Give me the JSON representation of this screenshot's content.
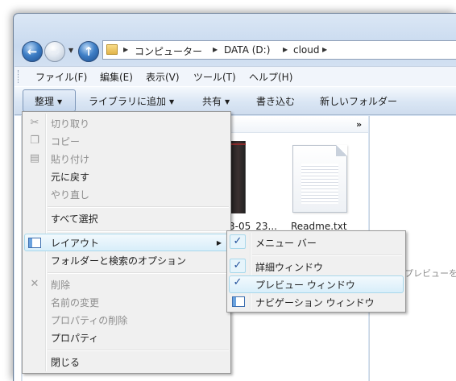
{
  "address": {
    "crumbs": [
      "コンピューター",
      "DATA (D:)",
      "cloud"
    ]
  },
  "menubar": {
    "items": [
      "ファイル(F)",
      "編集(E)",
      "表示(V)",
      "ツール(T)",
      "ヘルプ(H)"
    ]
  },
  "commandbar": {
    "organize": "整理",
    "add_to_library": "ライブラリに追加",
    "share": "共有",
    "burn": "書き込む",
    "new_folder": "新しいフォルダー"
  },
  "files": {
    "item1_label": "3-05_23...",
    "item2_label": "Readme.txt"
  },
  "preview": {
    "text": "プレビューを"
  },
  "organize_menu": {
    "cut": "切り取り",
    "copy": "コピー",
    "paste": "貼り付け",
    "undo": "元に戻す",
    "redo": "やり直し",
    "select_all": "すべて選択",
    "layout": "レイアウト",
    "folder_options": "フォルダーと検索のオプション",
    "delete": "削除",
    "rename": "名前の変更",
    "remove_properties": "プロパティの削除",
    "properties": "プロパティ",
    "close": "閉じる"
  },
  "layout_submenu": {
    "menu_bar": "メニュー バー",
    "details_pane": "詳細ウィンドウ",
    "preview_pane": "プレビュー ウィンドウ",
    "navigation_pane": "ナビゲーション ウィンドウ",
    "menu_bar_checked": true,
    "details_pane_checked": true,
    "preview_pane_checked": true,
    "navigation_pane_checked": false
  },
  "icons": {
    "back": "back-arrow-icon",
    "forward": "forward-arrow-icon",
    "up": "up-arrow-icon",
    "cut": "scissors-icon",
    "copy": "copy-icon",
    "paste": "clipboard-icon",
    "delete": "delete-x-icon",
    "layout": "layout-icon"
  },
  "colors": {
    "hover_border": "#a8d8eb",
    "check": "#1f4e9a",
    "menu_bg": "#f0f0f0"
  }
}
